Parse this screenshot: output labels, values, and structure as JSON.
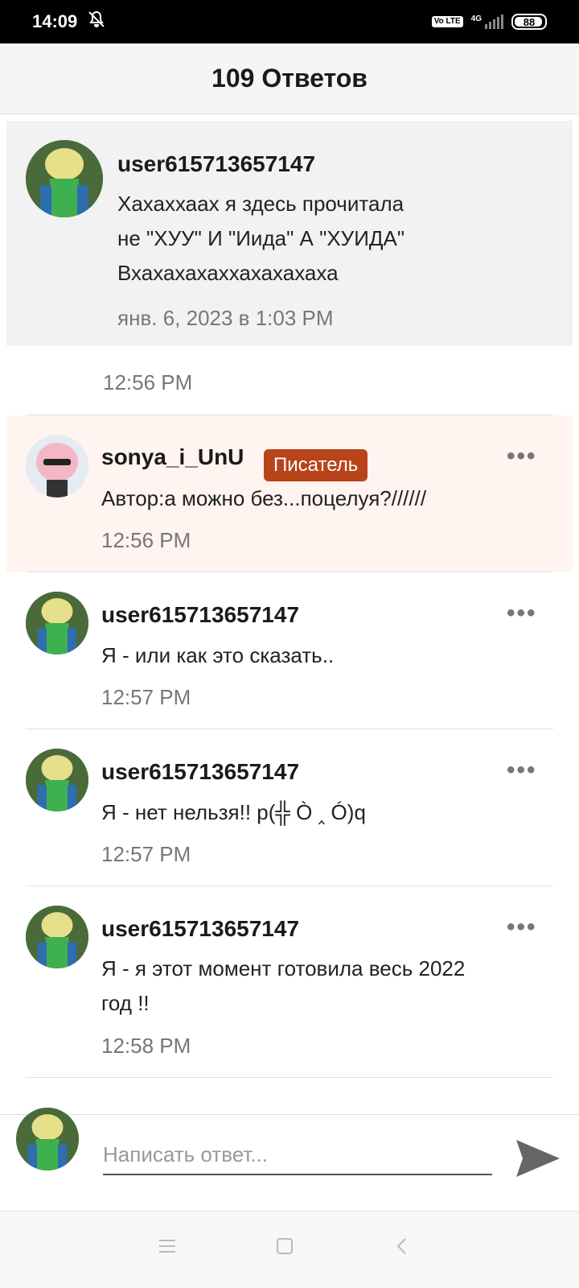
{
  "status_bar": {
    "time": "14:09",
    "network": "4G",
    "volte": "Vo LTE",
    "battery": "88"
  },
  "header": {
    "title": "109 Ответов"
  },
  "parent_comment": {
    "username": "user615713657147",
    "text_lines": [
      "Хахаххаах я здесь прочитала",
      "не \"ХУУ\" И \"Иида\" А \"ХУИДА\"",
      "Вхахахахаххахахахаха"
    ],
    "timestamp": "янв. 6, 2023 в 1:03 PM"
  },
  "partial_reply": {
    "time": "12:56 PM"
  },
  "replies": [
    {
      "username": "sonya_i_UnU",
      "badge": "Писатель",
      "text": "Автор:а можно без...поцелуя?//////",
      "time": "12:56 PM"
    },
    {
      "username": "user615713657147",
      "text": "Я - или как это сказать..",
      "time": "12:57 PM"
    },
    {
      "username": "user615713657147",
      "text": "Я - нет нельзя!! p(╬ Ò ‸ Ó)q",
      "time": "12:57 PM"
    },
    {
      "username": "user615713657147",
      "text_lines": [
        "Я - я этот момент готовила весь 2022",
        "год !!"
      ],
      "time": "12:58 PM"
    }
  ],
  "more_label": "•••",
  "composer": {
    "placeholder": "Написать ответ..."
  },
  "colors": {
    "badge": "#b8441a",
    "highlight_bg": "#fff4ef",
    "header_bg": "#f5f5f5"
  },
  "icons": {
    "send": "send-icon",
    "nav_menu": "menu-icon",
    "nav_home": "home-icon",
    "nav_back": "back-icon"
  }
}
